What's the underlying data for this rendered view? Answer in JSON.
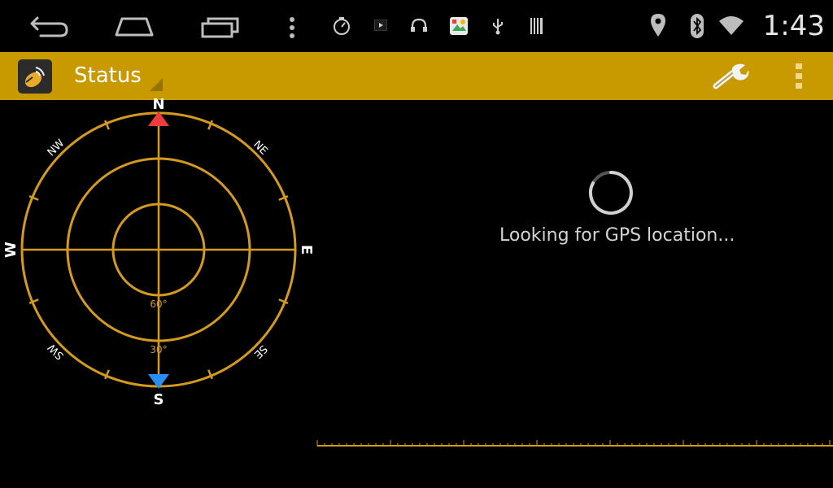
{
  "status_bar": {
    "time": "1:43",
    "nav_icons": [
      "back-icon",
      "home-icon",
      "recents-icon",
      "overflow-menu-icon"
    ],
    "notification_icons": [
      "stopwatch-icon",
      "video-play-icon",
      "headphones-icon",
      "photos-icon",
      "usb-icon",
      "barcode-icon"
    ],
    "system_icons": [
      "location-icon",
      "bluetooth-icon",
      "wifi-icon"
    ]
  },
  "action_bar": {
    "title": "Status",
    "accent_color": "#c99a00",
    "actions": [
      "wrench-icon",
      "more-vert-icon"
    ]
  },
  "compass": {
    "directions": {
      "n": "N",
      "s": "S",
      "e": "E",
      "w": "W",
      "ne": "NE",
      "nw": "NW",
      "se": "SE",
      "sw": "SW"
    },
    "elevation_labels": {
      "inner": "60°",
      "outer": "30°"
    },
    "ring_color": "#d49a1e",
    "north_marker_color": "#ee3b3b",
    "south_marker_color": "#2a8ef0"
  },
  "main": {
    "status_message": "Looking for GPS location..."
  }
}
